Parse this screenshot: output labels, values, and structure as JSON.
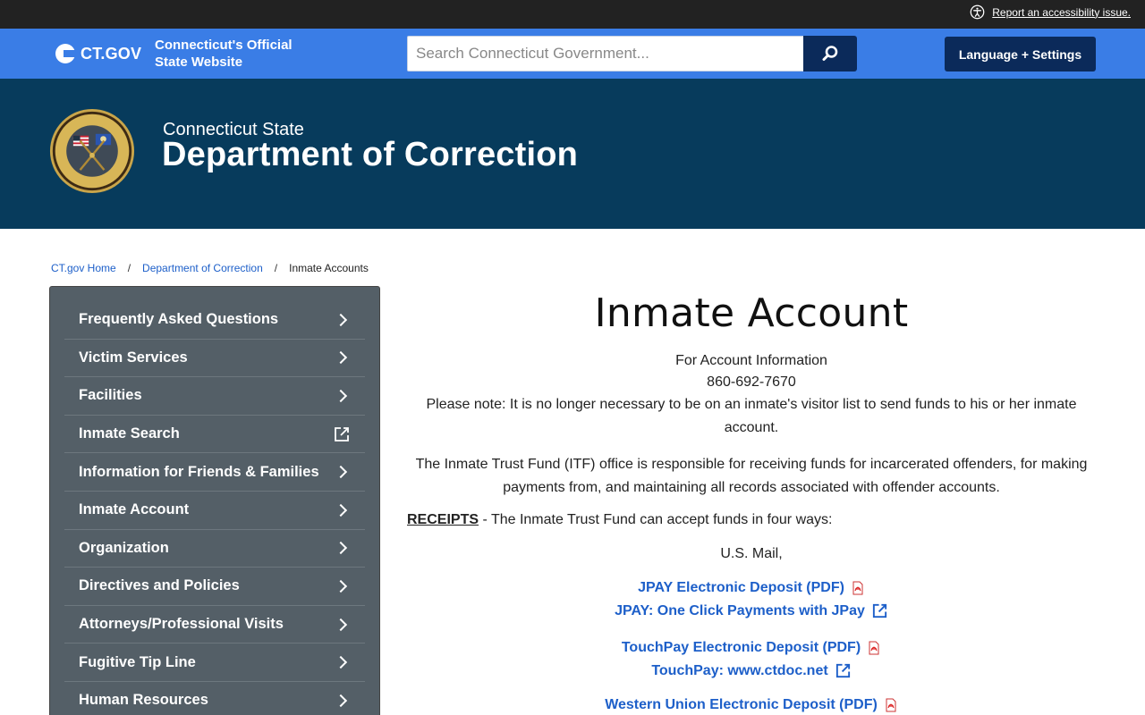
{
  "topbar": {
    "accessibility_link": "Report an accessibility issue."
  },
  "ctbar": {
    "logo_text": "CT.GOV",
    "tagline_line1": "Connecticut's Official",
    "tagline_line2": "State Website",
    "search_placeholder": "Search Connecticut Government...",
    "language_button": "Language + Settings"
  },
  "banner": {
    "subtitle": "Connecticut State",
    "title": "Department of Correction"
  },
  "breadcrumb": [
    {
      "label": "CT.gov Home"
    },
    {
      "label": "Department of Correction"
    },
    {
      "label": "Inmate Accounts"
    }
  ],
  "sidenav": {
    "items": [
      {
        "label": "Frequently Asked Questions",
        "icon": "chevron-right-icon"
      },
      {
        "label": "Victim Services",
        "icon": "chevron-right-icon"
      },
      {
        "label": "Facilities",
        "icon": "chevron-right-icon"
      },
      {
        "label": "Inmate Search",
        "icon": "external-link-icon"
      },
      {
        "label": "Information for Friends & Families",
        "icon": "chevron-right-icon"
      },
      {
        "label": "Inmate Account",
        "icon": "chevron-right-icon"
      },
      {
        "label": "Organization",
        "icon": "chevron-right-icon"
      },
      {
        "label": "Directives and Policies",
        "icon": "chevron-right-icon"
      },
      {
        "label": "Attorneys/Professional Visits",
        "icon": "chevron-right-icon"
      },
      {
        "label": "Fugitive Tip Line",
        "icon": "chevron-right-icon"
      },
      {
        "label": "Human Resources",
        "icon": "chevron-right-icon"
      }
    ]
  },
  "main": {
    "title": "Inmate Account",
    "account_info": "For Account Information",
    "phone": "860-692-7670",
    "note": "Please note: It is no longer necessary to be on an inmate's visitor list to send funds to his or her inmate account.",
    "itf_paragraph": "The Inmate Trust Fund (ITF) office is responsible for receiving funds for incarcerated offenders, for making payments from, and maintaining all records associated with offender accounts.",
    "receipts_label": "RECEIPTS",
    "receipts_text": " - The Inmate Trust Fund can accept funds in four ways:",
    "mail": "U.S. Mail,",
    "links": {
      "jpay_pdf": "JPAY Electronic Deposit (PDF)",
      "jpay_web": "JPAY: One Click Payments with JPay",
      "touchpay_pdf": "TouchPay Electronic Deposit (PDF)",
      "touchpay_web": "TouchPay: www.ctdoc.net",
      "western_union_pdf": "Western Union Electronic Deposit (PDF)"
    }
  }
}
